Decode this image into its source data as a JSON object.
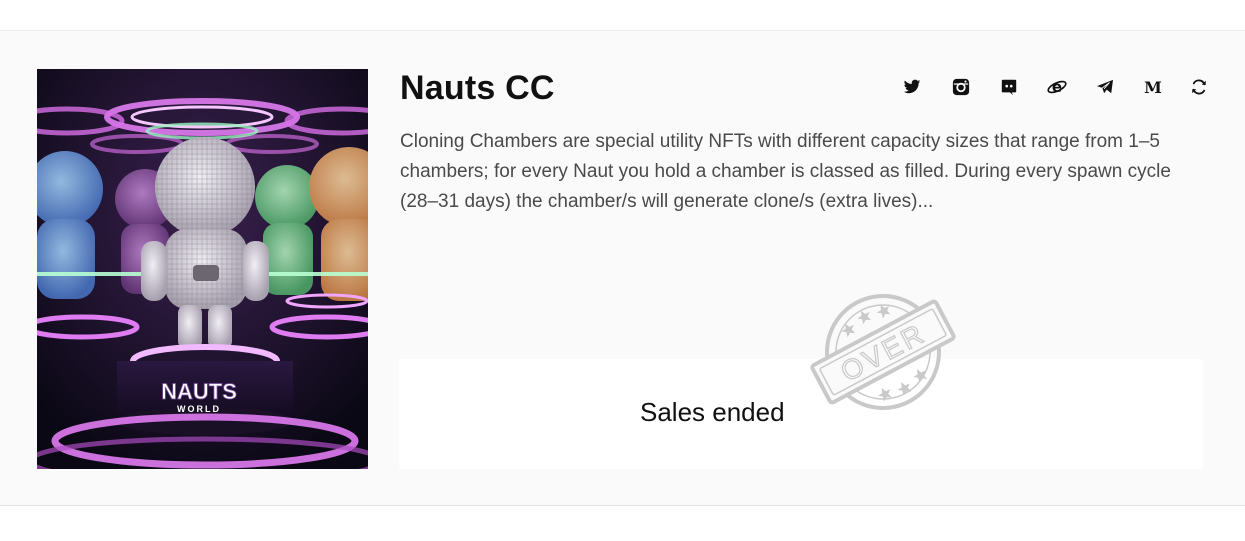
{
  "project": {
    "title": "Nauts CC",
    "description": "Cloning Chambers are special utility NFTs with different capacity sizes that range from 1–5 chambers; for every Naut you hold a chamber is classed as filled. During every spawn cycle (28–31 days) the chamber/s will generate clone/s (extra lives)...",
    "image_logo_text": "NAUTS",
    "image_logo_subtext": "WORLD"
  },
  "socials": [
    {
      "name": "twitter-icon"
    },
    {
      "name": "instagram-icon"
    },
    {
      "name": "discord-icon"
    },
    {
      "name": "website-icon"
    },
    {
      "name": "telegram-icon"
    },
    {
      "name": "medium-icon"
    },
    {
      "name": "refresh-icon"
    }
  ],
  "sales": {
    "status_text": "Sales ended",
    "stamp_text": "OVER"
  },
  "colors": {
    "card_bg": "#fafafa",
    "neon_pink": "#e07cf2",
    "neon_green": "#7cf5a2",
    "stamp_gray": "#c9c9c9"
  }
}
